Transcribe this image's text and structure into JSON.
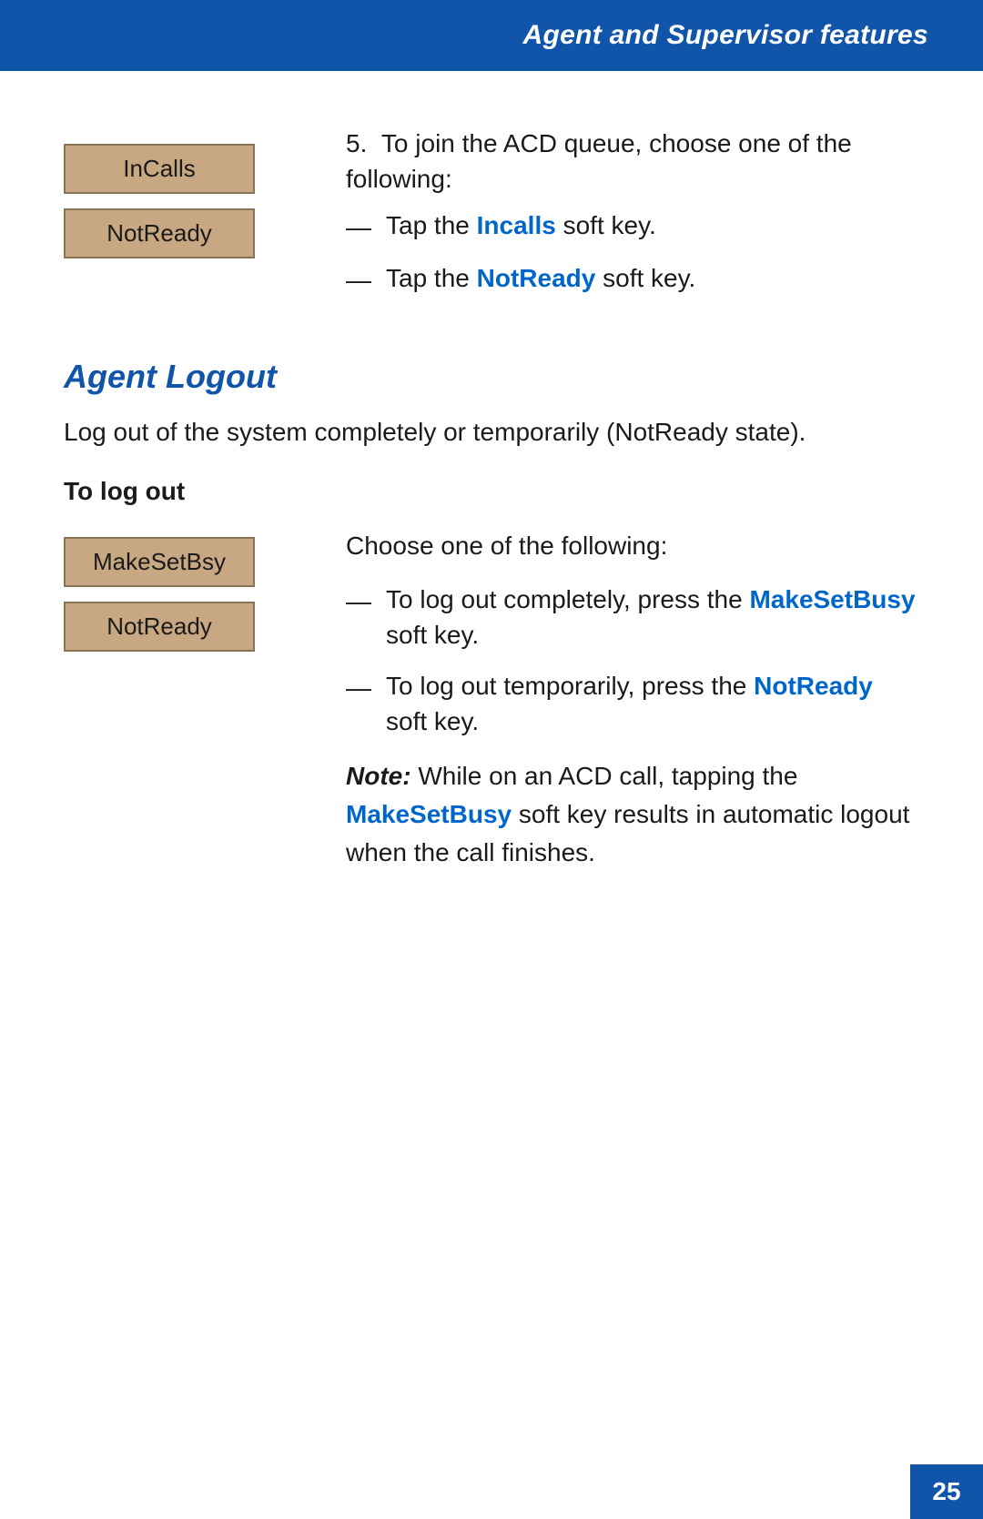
{
  "header": {
    "title": "Agent and Supervisor features",
    "background_color": "#1155aa"
  },
  "step5": {
    "number": "5.",
    "text": "To join the ACD queue, choose one of the following:",
    "keys": [
      {
        "label": "InCalls"
      },
      {
        "label": "NotReady"
      }
    ],
    "bullets": [
      {
        "dash": "—",
        "prefix": "Tap the ",
        "highlight": "Incalls",
        "suffix": " soft key."
      },
      {
        "dash": "—",
        "prefix": "Tap the ",
        "highlight": "NotReady",
        "suffix": " soft key."
      }
    ]
  },
  "agent_logout": {
    "heading": "Agent Logout",
    "description": "Log out of the system completely or temporarily (NotReady state).",
    "sub_heading": "To log out",
    "choose_text": "Choose one of the following:",
    "keys": [
      {
        "label": "MakeSetBsy"
      },
      {
        "label": "NotReady"
      }
    ],
    "bullets": [
      {
        "dash": "—",
        "prefix": "To log out completely, press the ",
        "highlight": "MakeSetBusy",
        "suffix": " soft key."
      },
      {
        "dash": "—",
        "prefix": "To log out temporarily, press the ",
        "highlight": "NotReady",
        "suffix": " soft key."
      }
    ],
    "note": {
      "label": "Note:",
      "prefix": " While on an ACD call, tapping the ",
      "highlight": "MakeSetBusy",
      "suffix": " soft key results in automatic logout when the call finishes."
    }
  },
  "page_number": "25"
}
